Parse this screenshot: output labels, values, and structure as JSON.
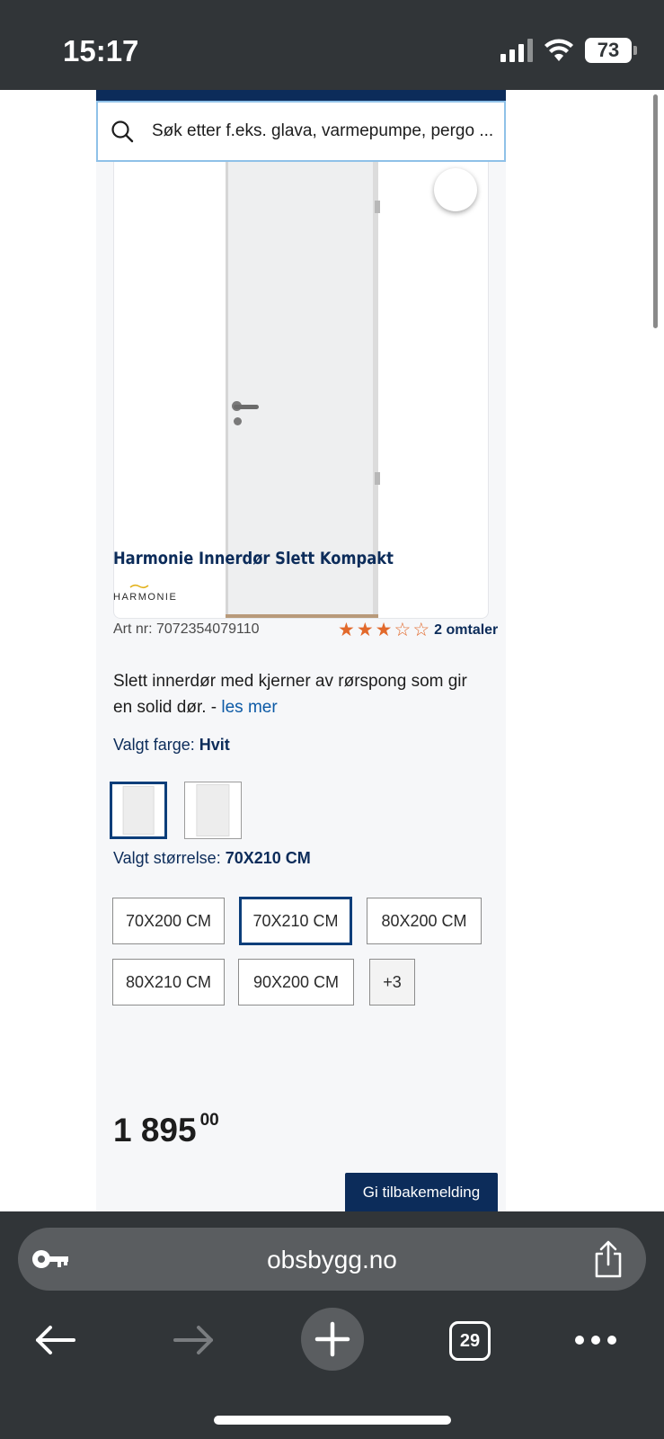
{
  "status_bar": {
    "time": "15:17",
    "battery": "73"
  },
  "search": {
    "placeholder": "Søk etter f.eks. glava, varmepumpe, pergo ..."
  },
  "product": {
    "title": "Harmonie Innerdør Slett Kompakt",
    "brand": "HARMONIE",
    "art_nr": "Art nr: 7072354079110",
    "rating": {
      "value": 3,
      "max": 5
    },
    "reviews_label": "2 omtaler",
    "description": "Slett innerdør med kjerner av rørspong som gir en solid dør. - ",
    "read_more": "les mer",
    "color_label": "Valgt farge: ",
    "color_value": "Hvit",
    "size_label": "Valgt størrelse: ",
    "size_value": "70X210 CM",
    "sizes": [
      "70X200 CM",
      "70X210 CM",
      "80X200 CM",
      "80X210 CM",
      "90X200 CM",
      "+3"
    ],
    "price_main": "1 895",
    "price_cents": "00",
    "feedback_button": "Gi tilbakemelding"
  },
  "colors": {
    "brand_navy": "#0c2c5a",
    "star_orange": "#e2692b",
    "link_blue": "#0c5aa6"
  },
  "browser": {
    "url": "obsbygg.no",
    "tab_count": "29"
  }
}
